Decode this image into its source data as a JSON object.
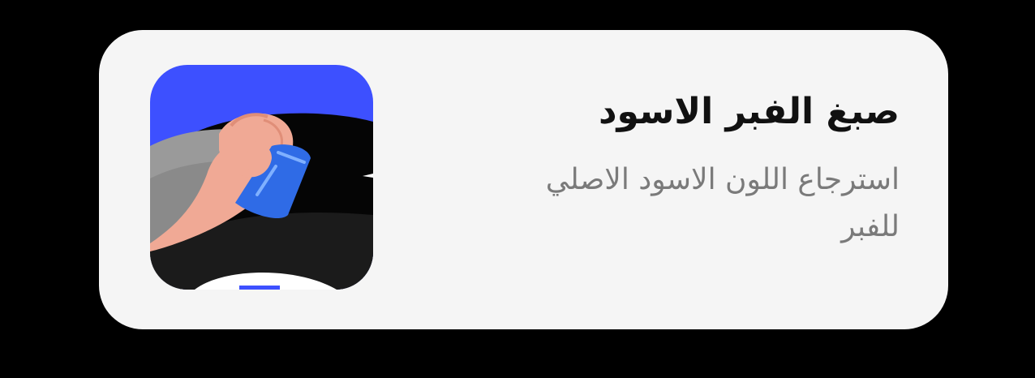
{
  "service": {
    "title": "صبغ الفبر الاسود",
    "description": " استرجاع اللون الاسود الاصلي للفبر",
    "image_icon": "tire-polish-hand-illustration"
  },
  "colors": {
    "card_background": "#f5f5f5",
    "page_background": "#000000",
    "illustration_blue": "#3d50ff",
    "sponge_blue": "#2f6be6",
    "skin": "#f0a995",
    "tire_black": "#1b1b1b"
  }
}
